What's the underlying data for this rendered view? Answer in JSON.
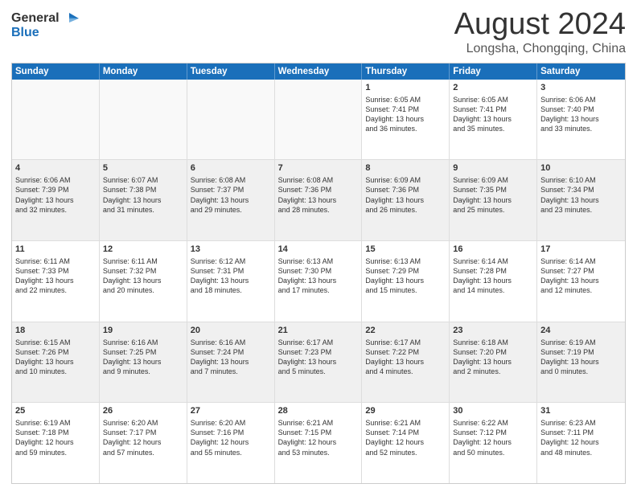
{
  "logo": {
    "line1": "General",
    "line2": "Blue"
  },
  "title": "August 2024",
  "location": "Longsha, Chongqing, China",
  "header_days": [
    "Sunday",
    "Monday",
    "Tuesday",
    "Wednesday",
    "Thursday",
    "Friday",
    "Saturday"
  ],
  "weeks": [
    [
      {
        "day": "",
        "text": "",
        "empty": true
      },
      {
        "day": "",
        "text": "",
        "empty": true
      },
      {
        "day": "",
        "text": "",
        "empty": true
      },
      {
        "day": "",
        "text": "",
        "empty": true
      },
      {
        "day": "1",
        "text": "Sunrise: 6:05 AM\nSunset: 7:41 PM\nDaylight: 13 hours\nand 36 minutes."
      },
      {
        "day": "2",
        "text": "Sunrise: 6:05 AM\nSunset: 7:41 PM\nDaylight: 13 hours\nand 35 minutes."
      },
      {
        "day": "3",
        "text": "Sunrise: 6:06 AM\nSunset: 7:40 PM\nDaylight: 13 hours\nand 33 minutes."
      }
    ],
    [
      {
        "day": "4",
        "text": "Sunrise: 6:06 AM\nSunset: 7:39 PM\nDaylight: 13 hours\nand 32 minutes."
      },
      {
        "day": "5",
        "text": "Sunrise: 6:07 AM\nSunset: 7:38 PM\nDaylight: 13 hours\nand 31 minutes."
      },
      {
        "day": "6",
        "text": "Sunrise: 6:08 AM\nSunset: 7:37 PM\nDaylight: 13 hours\nand 29 minutes."
      },
      {
        "day": "7",
        "text": "Sunrise: 6:08 AM\nSunset: 7:36 PM\nDaylight: 13 hours\nand 28 minutes."
      },
      {
        "day": "8",
        "text": "Sunrise: 6:09 AM\nSunset: 7:36 PM\nDaylight: 13 hours\nand 26 minutes."
      },
      {
        "day": "9",
        "text": "Sunrise: 6:09 AM\nSunset: 7:35 PM\nDaylight: 13 hours\nand 25 minutes."
      },
      {
        "day": "10",
        "text": "Sunrise: 6:10 AM\nSunset: 7:34 PM\nDaylight: 13 hours\nand 23 minutes."
      }
    ],
    [
      {
        "day": "11",
        "text": "Sunrise: 6:11 AM\nSunset: 7:33 PM\nDaylight: 13 hours\nand 22 minutes."
      },
      {
        "day": "12",
        "text": "Sunrise: 6:11 AM\nSunset: 7:32 PM\nDaylight: 13 hours\nand 20 minutes."
      },
      {
        "day": "13",
        "text": "Sunrise: 6:12 AM\nSunset: 7:31 PM\nDaylight: 13 hours\nand 18 minutes."
      },
      {
        "day": "14",
        "text": "Sunrise: 6:13 AM\nSunset: 7:30 PM\nDaylight: 13 hours\nand 17 minutes."
      },
      {
        "day": "15",
        "text": "Sunrise: 6:13 AM\nSunset: 7:29 PM\nDaylight: 13 hours\nand 15 minutes."
      },
      {
        "day": "16",
        "text": "Sunrise: 6:14 AM\nSunset: 7:28 PM\nDaylight: 13 hours\nand 14 minutes."
      },
      {
        "day": "17",
        "text": "Sunrise: 6:14 AM\nSunset: 7:27 PM\nDaylight: 13 hours\nand 12 minutes."
      }
    ],
    [
      {
        "day": "18",
        "text": "Sunrise: 6:15 AM\nSunset: 7:26 PM\nDaylight: 13 hours\nand 10 minutes."
      },
      {
        "day": "19",
        "text": "Sunrise: 6:16 AM\nSunset: 7:25 PM\nDaylight: 13 hours\nand 9 minutes."
      },
      {
        "day": "20",
        "text": "Sunrise: 6:16 AM\nSunset: 7:24 PM\nDaylight: 13 hours\nand 7 minutes."
      },
      {
        "day": "21",
        "text": "Sunrise: 6:17 AM\nSunset: 7:23 PM\nDaylight: 13 hours\nand 5 minutes."
      },
      {
        "day": "22",
        "text": "Sunrise: 6:17 AM\nSunset: 7:22 PM\nDaylight: 13 hours\nand 4 minutes."
      },
      {
        "day": "23",
        "text": "Sunrise: 6:18 AM\nSunset: 7:20 PM\nDaylight: 13 hours\nand 2 minutes."
      },
      {
        "day": "24",
        "text": "Sunrise: 6:19 AM\nSunset: 7:19 PM\nDaylight: 13 hours\nand 0 minutes."
      }
    ],
    [
      {
        "day": "25",
        "text": "Sunrise: 6:19 AM\nSunset: 7:18 PM\nDaylight: 12 hours\nand 59 minutes."
      },
      {
        "day": "26",
        "text": "Sunrise: 6:20 AM\nSunset: 7:17 PM\nDaylight: 12 hours\nand 57 minutes."
      },
      {
        "day": "27",
        "text": "Sunrise: 6:20 AM\nSunset: 7:16 PM\nDaylight: 12 hours\nand 55 minutes."
      },
      {
        "day": "28",
        "text": "Sunrise: 6:21 AM\nSunset: 7:15 PM\nDaylight: 12 hours\nand 53 minutes."
      },
      {
        "day": "29",
        "text": "Sunrise: 6:21 AM\nSunset: 7:14 PM\nDaylight: 12 hours\nand 52 minutes."
      },
      {
        "day": "30",
        "text": "Sunrise: 6:22 AM\nSunset: 7:12 PM\nDaylight: 12 hours\nand 50 minutes."
      },
      {
        "day": "31",
        "text": "Sunrise: 6:23 AM\nSunset: 7:11 PM\nDaylight: 12 hours\nand 48 minutes."
      }
    ]
  ]
}
